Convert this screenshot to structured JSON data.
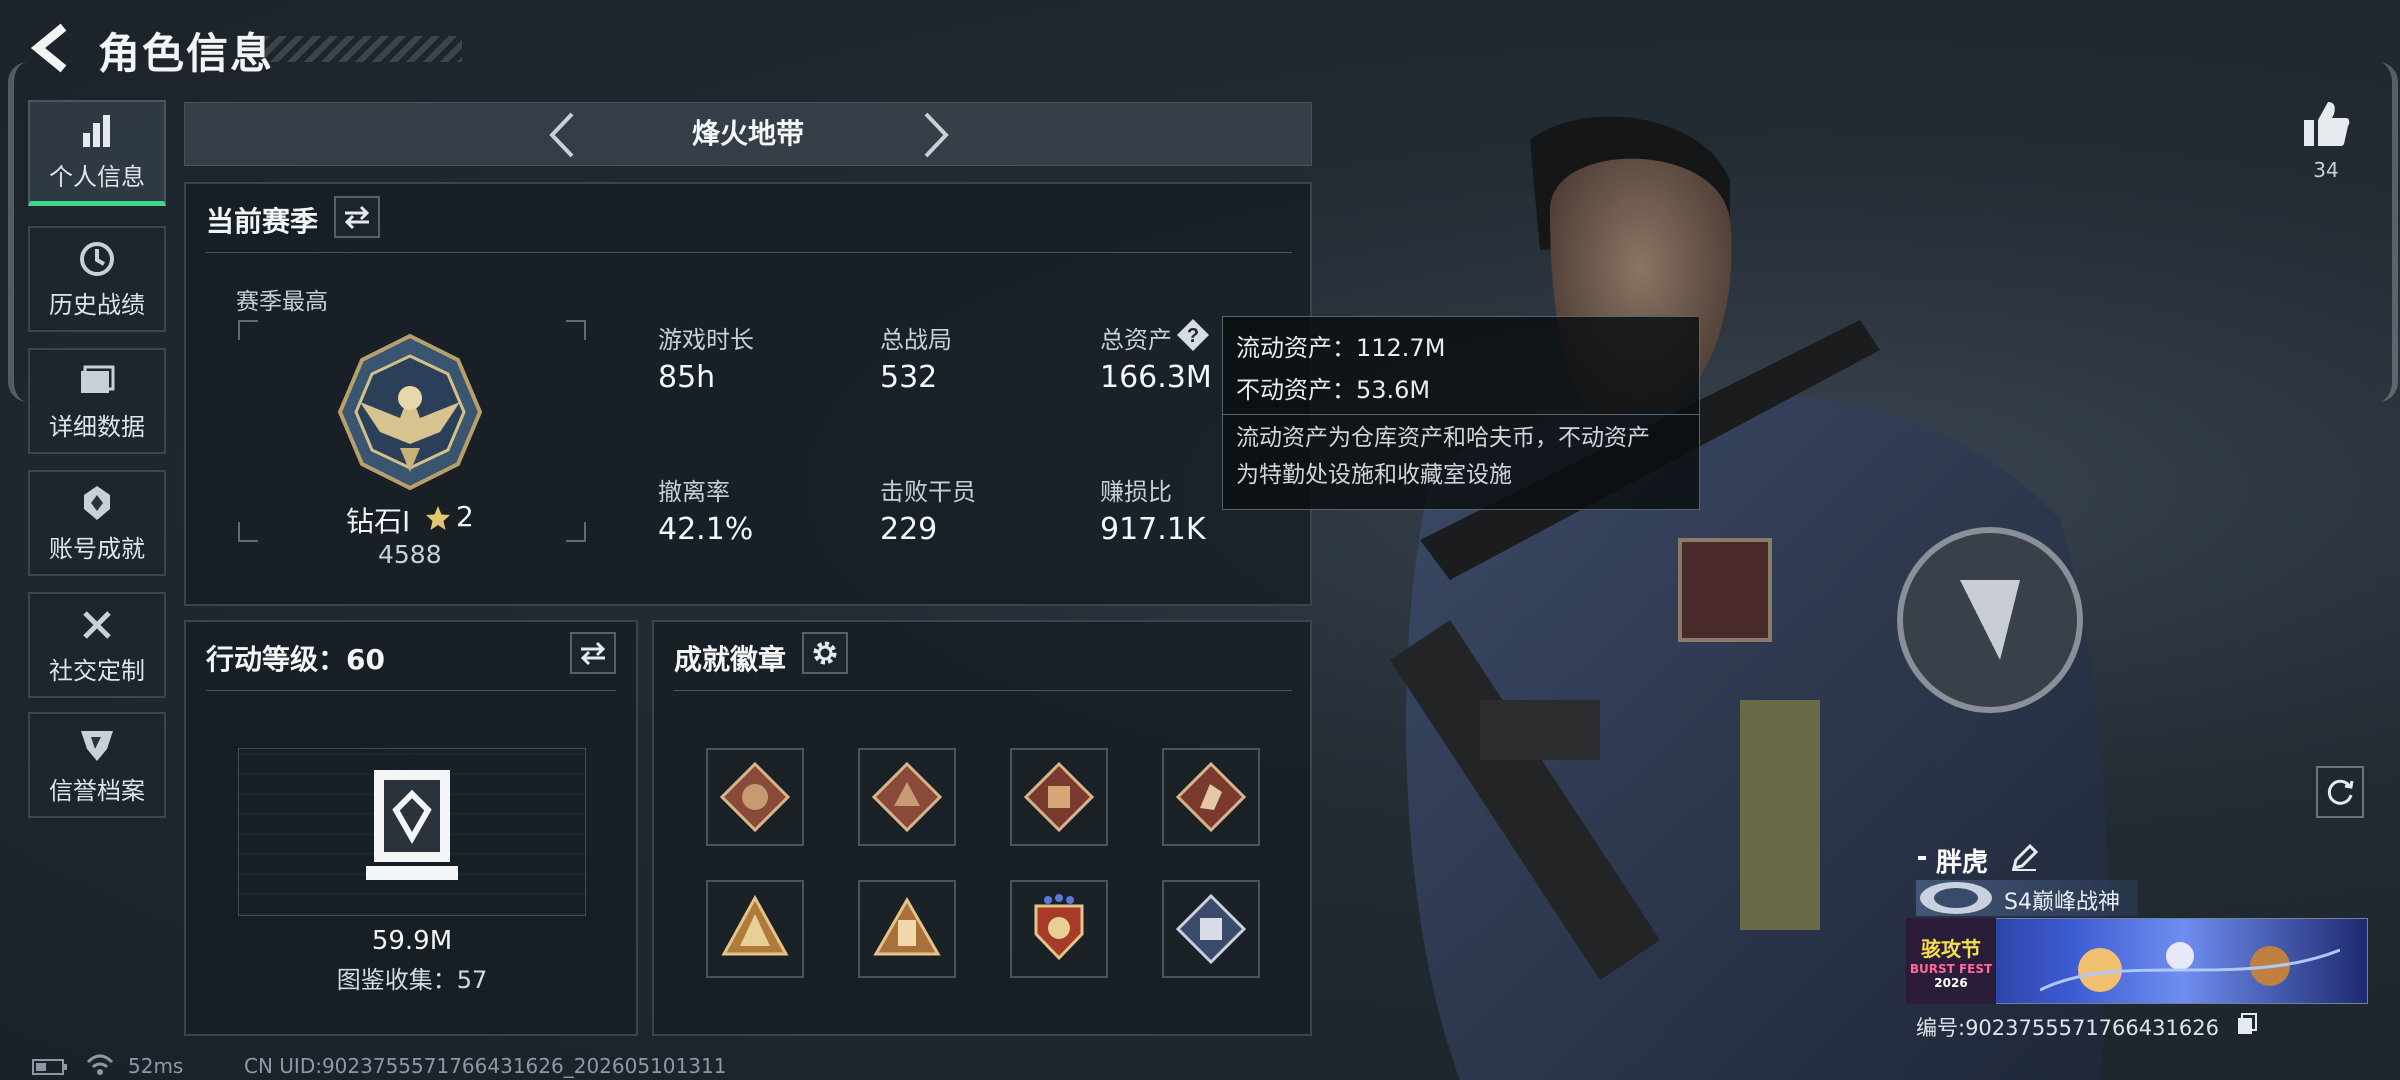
{
  "header": {
    "title": "角色信息"
  },
  "sidebar": {
    "items": [
      {
        "label": "个人信息",
        "icon": "bar-chart-icon",
        "active": true
      },
      {
        "label": "历史战绩",
        "icon": "history-clock-icon"
      },
      {
        "label": "详细数据",
        "icon": "folder-icon"
      },
      {
        "label": "账号成就",
        "icon": "achievement-shield-icon"
      },
      {
        "label": "社交定制",
        "icon": "tools-wrench-icon"
      },
      {
        "label": "信誉档案",
        "icon": "credit-shield-icon"
      }
    ]
  },
  "mode": {
    "title": "烽火地带"
  },
  "season": {
    "title": "当前赛季",
    "best_label": "赛季最高",
    "rank_name": "钻石I",
    "rank_stars": "2",
    "rank_points": "4588",
    "stats": [
      {
        "label": "游戏时长",
        "value": "85h"
      },
      {
        "label": "总战局",
        "value": "532"
      },
      {
        "label": "总资产",
        "value": "166.3M"
      },
      {
        "label": "撤离率",
        "value": "42.1%"
      },
      {
        "label": "击败干员",
        "value": "229"
      },
      {
        "label": "赚损比",
        "value": "917.1K"
      }
    ]
  },
  "tooltip": {
    "liquid": "流动资产：112.7M",
    "fixed": "不动资产：53.6M",
    "desc_line1": "流动资产为仓库资产和哈夫币，不动资产",
    "desc_line2": "为特勤处设施和收藏室设施"
  },
  "action_level": {
    "title": "行动等级：60",
    "value": "59.9M",
    "collection": "图鉴收集：57"
  },
  "badges": {
    "title": "成就徽章",
    "items": [
      "wolf-badge-icon",
      "dragon-badge-icon",
      "beast-badge-icon",
      "runner-badge-icon",
      "mountain-badge-icon",
      "hand-badge-icon",
      "crest-badge-icon",
      "cube-badge-icon"
    ]
  },
  "profile": {
    "likes": "34",
    "nickname": "胖虎",
    "rank_title": "S4巅峰战神",
    "card_text": "骇攻节",
    "card_sub": "BURST FEST",
    "card_year": "2026",
    "uid": "编号:9023755571766431626"
  },
  "footer": {
    "ping": "52ms",
    "uid": "CN UID:9023755571766431626_202605101311"
  },
  "colors": {
    "accent_green": "#3fd68a",
    "panel_border": "#3a444f"
  }
}
